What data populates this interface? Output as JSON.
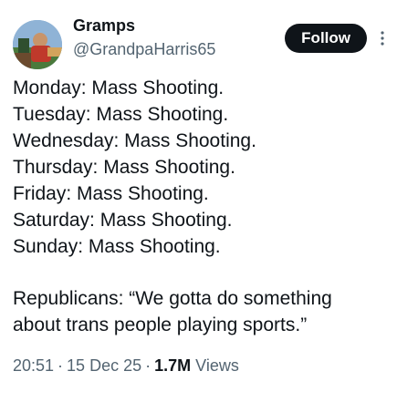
{
  "author": {
    "display_name": "Gramps",
    "handle": "@GrandpaHarris65",
    "avatar_icon": "profile-photo-avatar"
  },
  "actions": {
    "follow_label": "Follow",
    "more_icon": "more-options-icon"
  },
  "tweet": {
    "days": [
      "Monday: Mass Shooting.",
      "Tuesday: Mass Shooting.",
      "Wednesday: Mass Shooting.",
      "Thursday: Mass Shooting.",
      "Friday: Mass Shooting.",
      "Saturday: Mass Shooting.",
      "Sunday: Mass Shooting."
    ],
    "closing_line_1": "Republicans: “We gotta do something",
    "closing_line_2": "about trans people playing sports.”"
  },
  "meta": {
    "time": "20:51",
    "date": "15 Dec 25",
    "views_count": "1.7M",
    "views_label": "Views",
    "separator": "·"
  },
  "colors": {
    "text_primary": "#0f1419",
    "text_secondary": "#536471",
    "follow_bg": "#0f1419",
    "follow_text": "#ffffff"
  }
}
